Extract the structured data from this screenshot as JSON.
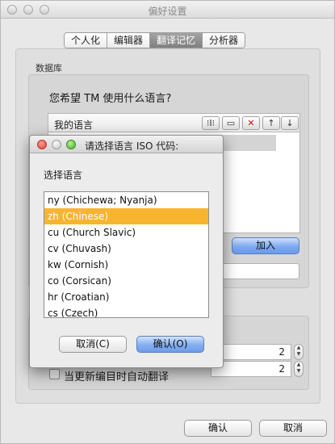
{
  "window": {
    "title": "偏好设置"
  },
  "tabs": [
    {
      "label": "个人化",
      "active": false
    },
    {
      "label": "编辑器",
      "active": false
    },
    {
      "label": "翻译记忆",
      "active": true
    },
    {
      "label": "分析器",
      "active": false
    }
  ],
  "group": {
    "label": "数据库",
    "question": "您希望 TM 使用什么语言?",
    "list_header": "我的语言",
    "add_button": "加入"
  },
  "settings": {
    "value_1": "2",
    "value_2": "2",
    "checkbox_label": "当更新编目时自动翻译",
    "checkbox_checked": false
  },
  "footer": {
    "ok": "确认",
    "cancel": "取消"
  },
  "dialog": {
    "title": "请选择语言 ISO 代码:",
    "label": "选择语言",
    "items": [
      {
        "label": "ny (Chichewa; Nyanja)",
        "selected": false
      },
      {
        "label": "zh (Chinese)",
        "selected": true
      },
      {
        "label": "cu (Church Slavic)",
        "selected": false
      },
      {
        "label": "cv (Chuvash)",
        "selected": false
      },
      {
        "label": "kw (Cornish)",
        "selected": false
      },
      {
        "label": "co (Corsican)",
        "selected": false
      },
      {
        "label": "hr (Croatian)",
        "selected": false
      },
      {
        "label": "cs (Czech)",
        "selected": false
      }
    ],
    "cancel": "取消(C)",
    "ok": "确认(O)"
  },
  "colors": {
    "selection": "#f7b52f",
    "active_tab": "#8c8c8c",
    "primary_button": "#7eaaf0"
  }
}
